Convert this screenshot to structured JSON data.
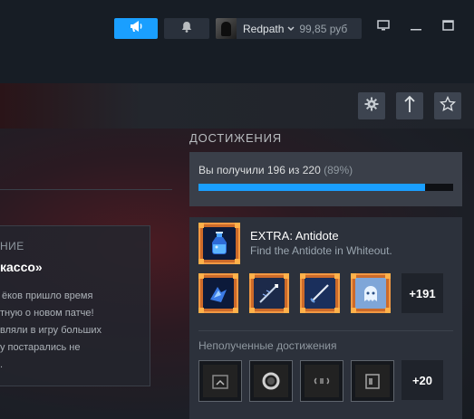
{
  "titlebar": {
    "account_name": "Redpath",
    "balance": "99,85 руб",
    "icons": [
      "megaphone-icon",
      "bell-icon",
      "chevron-down-icon",
      "monitor-icon",
      "minimize-icon",
      "maximize-icon"
    ]
  },
  "toolbar": {
    "icons": [
      "gear-icon",
      "upload-icon",
      "star-icon"
    ]
  },
  "news": {
    "kicker": "НИЕ",
    "title": "касco»",
    "lines": [
      "ёков пришло время",
      "тную о новом патче!",
      "вляли в игру больших",
      "у постарались не",
      "."
    ]
  },
  "achievements": {
    "heading": "ДОСТИЖЕНИЯ",
    "progress_label": "Вы получили 196 из 220",
    "progress_pct": "(89%)",
    "progress_fraction": 0.89,
    "featured": {
      "title": "EXTRA: Antidote",
      "description": "Find the Antidote in Whiteout."
    },
    "unlocked_icons": [
      "potion-icon",
      "blue-shard-icon",
      "spear-icon",
      "sword-icon",
      "ghost-icon"
    ],
    "unlocked_more": "+191",
    "locked_label": "Неполученные достижения",
    "locked_icons": [
      "slot-machine-icon",
      "ring-icon",
      "sound-wave-icon",
      "cabinet-icon"
    ],
    "locked_more": "+20",
    "accent_color": "#1a9fff",
    "frame_color": "#f29843"
  }
}
